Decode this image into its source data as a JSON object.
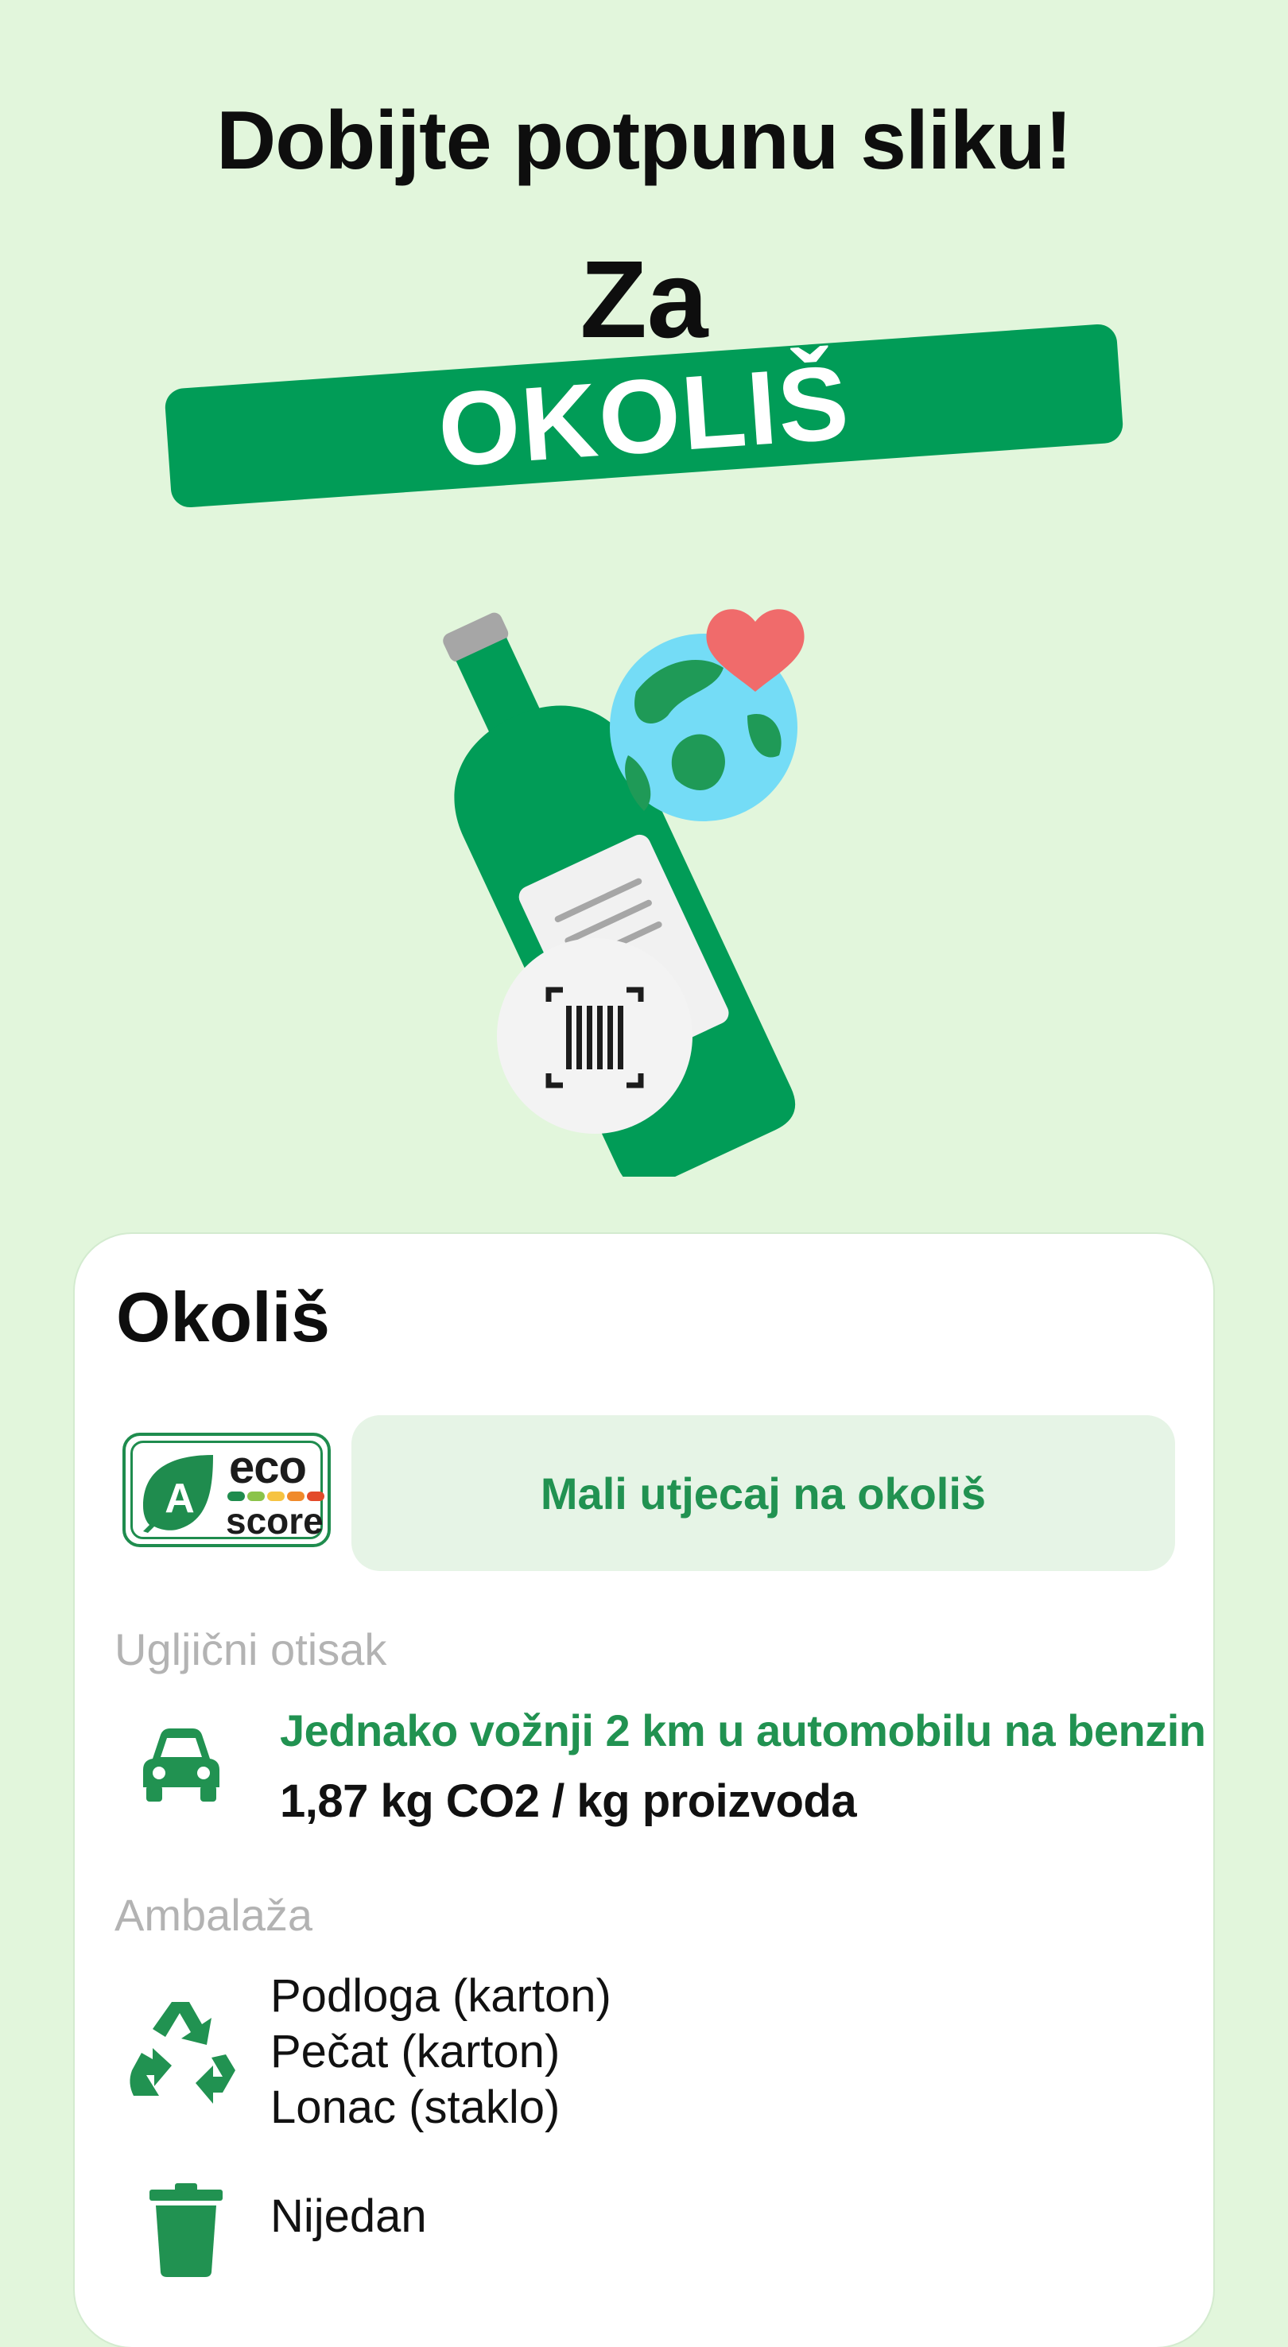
{
  "header": {
    "headline": "Dobijte potpunu sliku!",
    "prefix": "Za",
    "banner": "OKOLIŠ"
  },
  "colors": {
    "background": "#e2f6dc",
    "brand_green": "#019c57",
    "text_green": "#219251",
    "pill_bg": "#e6f4e6"
  },
  "card": {
    "title": "Okoliš",
    "ecoscore": {
      "grade": "A",
      "word_top": "eco",
      "word_bottom": "score",
      "bar_colors": [
        "#1f8c4e",
        "#8bc34a",
        "#f6c342",
        "#f08a2b",
        "#e34a2a"
      ],
      "summary": "Mali utjecaj na okoliš"
    },
    "carbon": {
      "label": "Ugljični otisak",
      "icon": "car-icon",
      "comparison": "Jednako vožnji 2 km u automobilu na benzin",
      "value": "1,87 kg CO2 / kg proizvoda"
    },
    "packaging": {
      "label": "Ambalaža",
      "recycle_icon": "recycle-icon",
      "recyclable": [
        "Podloga (karton)",
        "Pečat (karton)",
        "Lonac (staklo)"
      ],
      "trash_icon": "trash-icon",
      "non_recyclable": "Nijedan"
    }
  }
}
